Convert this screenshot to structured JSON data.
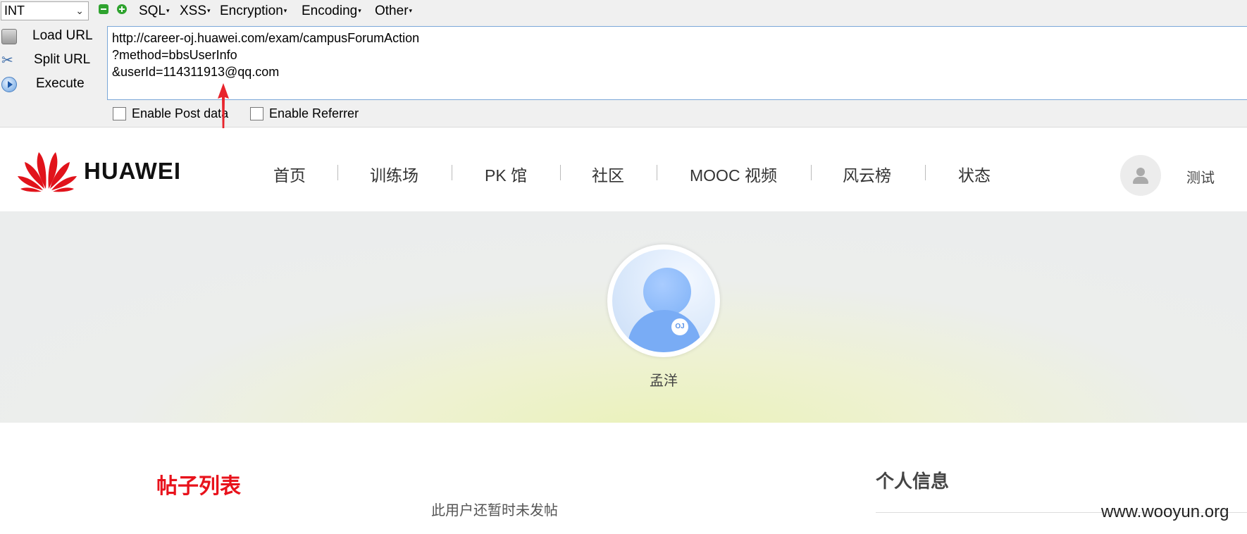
{
  "hackbar": {
    "select_value": "INT",
    "menus": [
      "SQL",
      "XSS",
      "Encryption",
      "Encoding",
      "Other"
    ],
    "side_buttons": [
      "Load URL",
      "Split URL",
      "Execute"
    ],
    "url_lines": [
      "http://career-oj.huawei.com/exam/campusForumAction",
      "?method=bbsUserInfo",
      "&userId=114311913@qq.com"
    ],
    "checkboxes": [
      "Enable Post data",
      "Enable Referrer"
    ],
    "arrow_color": "#e8242c"
  },
  "site": {
    "logo_text": "HUAWEI",
    "nav": [
      "首页",
      "训练场",
      "PK 馆",
      "社区",
      "MOOC 视频",
      "风云榜",
      "状态"
    ],
    "user_label": "测试"
  },
  "profile": {
    "avatar_badge": "OJ",
    "name": "孟洋"
  },
  "content": {
    "posts_title": "帖子列表",
    "empty_message": "此用户还暂时未发帖",
    "info_title": "个人信息",
    "accent_color": "#e8121b"
  },
  "watermark": "www.wooyun.org"
}
